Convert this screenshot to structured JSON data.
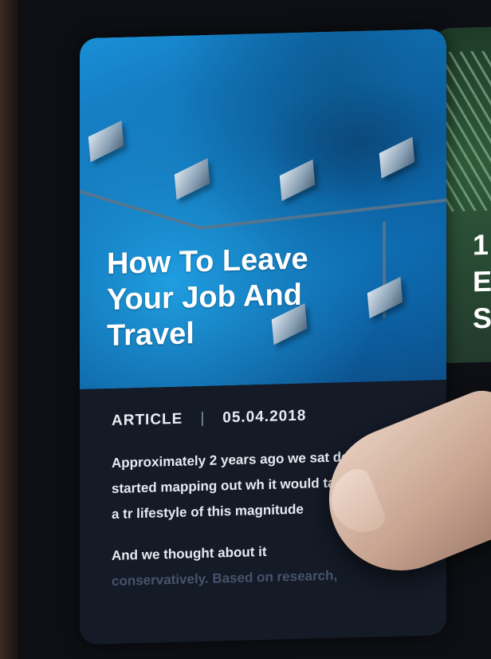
{
  "card": {
    "title": "How To Leave Your Job And Travel",
    "type_label": "ARTICLE",
    "separator": "|",
    "date": "05.04.2018",
    "excerpt_para1": "Approximately 2 years ago we sat down and started mapping out wh it would take to pull off a tr lifestyle of this magnitude",
    "excerpt_para2": "And we thought about it",
    "excerpt_para2_faded": "conservatively. Based on research,"
  },
  "next_card": {
    "title_fragment": "1\nE\nS"
  },
  "colors": {
    "hero_blue": "#1a8fd6",
    "card_bg": "#141a26",
    "text_light": "#e6eaf0"
  }
}
